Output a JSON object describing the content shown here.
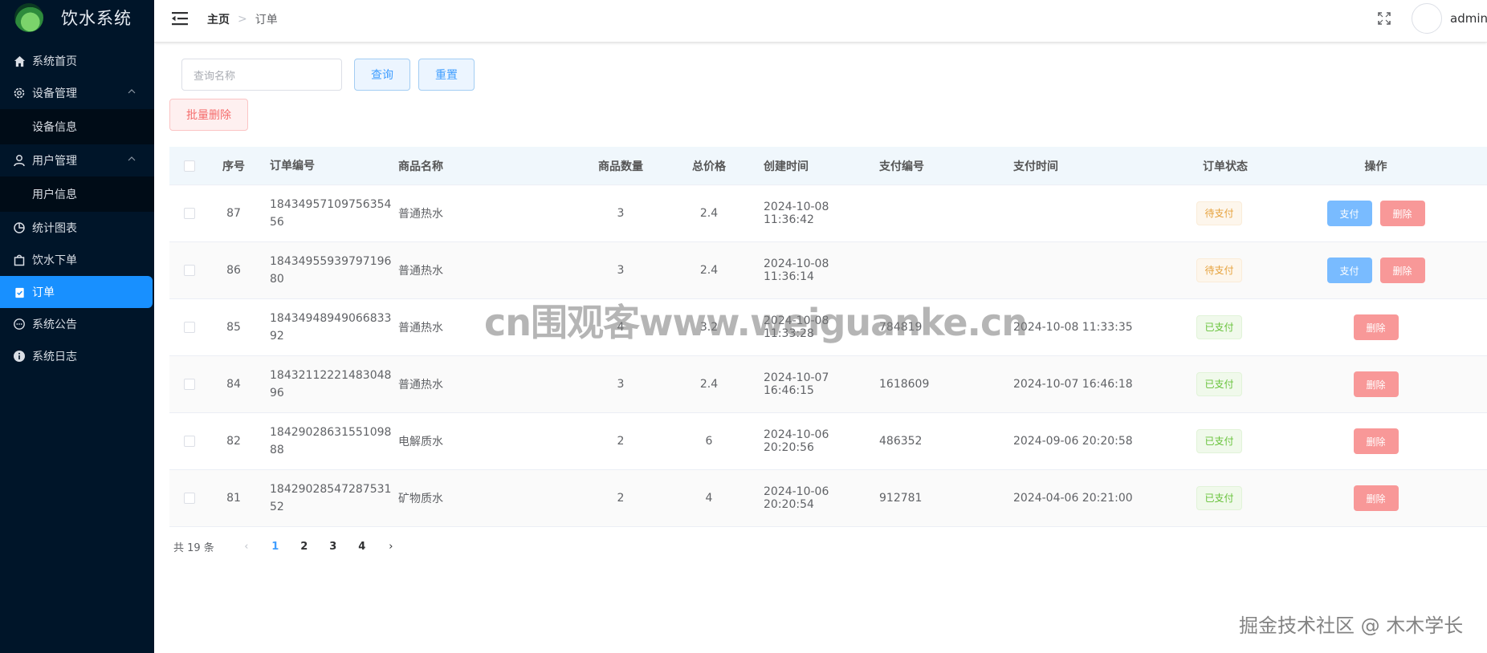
{
  "sidebar": {
    "app_title": "饮水系统",
    "items": [
      {
        "label": "系统首页",
        "icon": "home-icon"
      },
      {
        "label": "设备管理",
        "icon": "gear-icon"
      },
      {
        "label": "设备信息"
      },
      {
        "label": "用户管理",
        "icon": "user-icon"
      },
      {
        "label": "用户信息"
      },
      {
        "label": "统计图表",
        "icon": "pie-chart-icon"
      },
      {
        "label": "饮水下单",
        "icon": "shopping-bag-icon"
      },
      {
        "label": "订单",
        "icon": "order-icon"
      },
      {
        "label": "系统公告",
        "icon": "chat-icon"
      },
      {
        "label": "系统日志",
        "icon": "info-icon"
      }
    ],
    "active_color": "#1890ff",
    "bg_color": "#001529"
  },
  "header": {
    "breadcrumb_home": "主页",
    "breadcrumb_current": "订单",
    "username": "admin"
  },
  "search": {
    "placeholder": "查询名称",
    "query_label": "查询",
    "reset_label": "重置",
    "batch_delete_label": "批量删除"
  },
  "table": {
    "columns": [
      "序号",
      "订单编号",
      "商品名称",
      "商品数量",
      "总价格",
      "创建时间",
      "支付编号",
      "支付时间",
      "订单状态",
      "操作"
    ],
    "rows": [
      {
        "id": "87",
        "order_no": "1843495710975635456",
        "product": "普通热水",
        "qty": "3",
        "price": "2.4",
        "created": "2024-10-08 11:36:42",
        "pay_no": "",
        "pay_time": "",
        "status": "待支付",
        "pay_btn": "支付",
        "del_btn": "删除"
      },
      {
        "id": "86",
        "order_no": "1843495593979719680",
        "product": "普通热水",
        "qty": "3",
        "price": "2.4",
        "created": "2024-10-08 11:36:14",
        "pay_no": "",
        "pay_time": "",
        "status": "待支付",
        "pay_btn": "支付",
        "del_btn": "删除"
      },
      {
        "id": "85",
        "order_no": "1843494894906683392",
        "product": "普通热水",
        "qty": "4",
        "price": "3.2",
        "created": "2024-10-08 11:33:28",
        "pay_no": "784819",
        "pay_time": "2024-10-08 11:33:35",
        "status": "已支付",
        "del_btn": "删除"
      },
      {
        "id": "84",
        "order_no": "1843211222148304896",
        "product": "普通热水",
        "qty": "3",
        "price": "2.4",
        "created": "2024-10-07 16:46:15",
        "pay_no": "1618609",
        "pay_time": "2024-10-07 16:46:18",
        "status": "已支付",
        "del_btn": "删除"
      },
      {
        "id": "82",
        "order_no": "1842902863155109888",
        "product": "电解质水",
        "qty": "2",
        "price": "6",
        "created": "2024-10-06 20:20:56",
        "pay_no": "486352",
        "pay_time": "2024-09-06 20:20:58",
        "status": "已支付",
        "del_btn": "删除"
      },
      {
        "id": "81",
        "order_no": "1842902854728753152",
        "product": "矿物质水",
        "qty": "2",
        "price": "4",
        "created": "2024-10-06 20:20:54",
        "pay_no": "912781",
        "pay_time": "2024-04-06 20:21:00",
        "status": "已支付",
        "del_btn": "删除"
      }
    ]
  },
  "pagination": {
    "total": "共 19 条",
    "pages": [
      "1",
      "2",
      "3",
      "4"
    ],
    "current": "1"
  },
  "watermarks": {
    "center": "cn围观客www.weiguanke.cn",
    "corner": "掘金技术社区 @ 木木学长"
  }
}
